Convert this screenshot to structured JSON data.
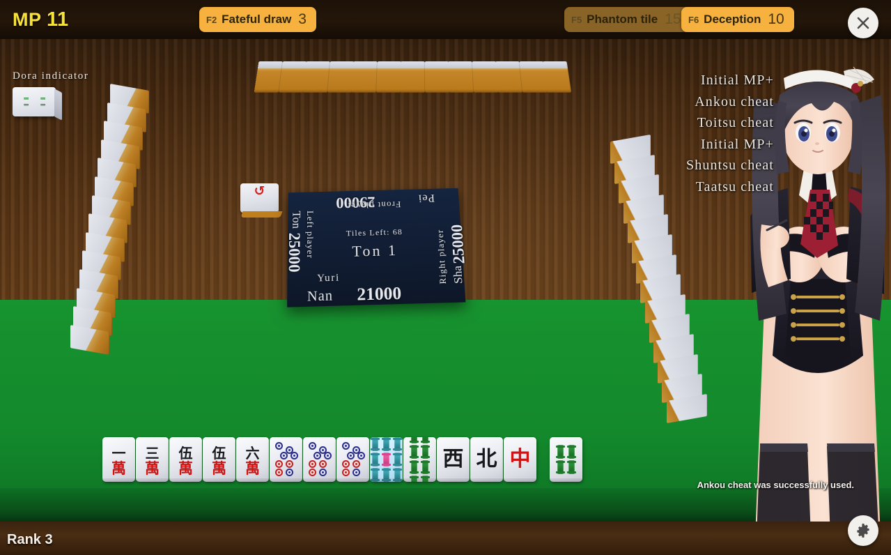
{
  "hud": {
    "mp_label": "MP",
    "mp_value": "11",
    "rank_label": "Rank 3",
    "status_message": "Ankou cheat was successfully used.",
    "close_icon": "close-icon",
    "settings_icon": "gear-icon"
  },
  "skills": [
    {
      "key": "F2",
      "name": "Fateful draw",
      "count": "3",
      "enabled": true
    },
    {
      "key": "F5",
      "name": "Phantom tile",
      "count": "15",
      "enabled": false
    },
    {
      "key": "F6",
      "name": "Deception",
      "count": "10",
      "enabled": true
    }
  ],
  "cheat_menu": {
    "items": [
      {
        "label": "Initial MP+"
      },
      {
        "label": "Ankou cheat"
      },
      {
        "label": "Toitsu cheat"
      },
      {
        "label": "Initial MP+"
      },
      {
        "label": "Shuntsu cheat"
      },
      {
        "label": "Taatsu cheat"
      }
    ]
  },
  "dora": {
    "label": "Dora indicator",
    "tile": "4-sou"
  },
  "scoreboard": {
    "tiles_left_label": "Tiles Left: 68",
    "round": "Ton 1",
    "front_player": {
      "name": "Front player",
      "wind": "Pei",
      "score": "29000"
    },
    "left_player": {
      "name": "Left player",
      "wind": "Ton",
      "score": "25000"
    },
    "right_player": {
      "name": "Right player",
      "wind": "Sha",
      "score": "25000"
    },
    "self_player": {
      "name": "Yuri",
      "wind": "Nan",
      "score": "21000"
    }
  },
  "turn_marker": {
    "glyph": "↺",
    "name": "dealer-marker"
  },
  "hand": {
    "tiles": [
      {
        "kind": "man",
        "num": "一",
        "wan": "萬",
        "label": "1-man",
        "selected": false
      },
      {
        "kind": "man",
        "num": "三",
        "wan": "萬",
        "label": "3-man",
        "selected": false
      },
      {
        "kind": "man",
        "num": "伍",
        "wan": "萬",
        "label": "5-man",
        "selected": false
      },
      {
        "kind": "man",
        "num": "伍",
        "wan": "萬",
        "label": "5-man",
        "selected": false
      },
      {
        "kind": "man",
        "num": "六",
        "wan": "萬",
        "label": "6-man",
        "selected": false
      },
      {
        "kind": "pin6",
        "label": "6-pin",
        "selected": false
      },
      {
        "kind": "pin6",
        "label": "6-pin",
        "selected": false
      },
      {
        "kind": "pin6",
        "label": "6-pin",
        "selected": false
      },
      {
        "kind": "sou5r",
        "label": "5-sou-red",
        "selected": true
      },
      {
        "kind": "sou8",
        "label": "8-sou",
        "selected": false
      },
      {
        "kind": "honor",
        "glyph": "西",
        "red": false,
        "label": "west-wind",
        "selected": false
      },
      {
        "kind": "honor",
        "glyph": "北",
        "red": false,
        "label": "north-wind",
        "selected": false
      },
      {
        "kind": "honor",
        "glyph": "中",
        "red": true,
        "label": "red-dragon",
        "selected": false
      }
    ],
    "drawn_tile": {
      "kind": "sou4",
      "label": "4-sou"
    }
  },
  "walls": {
    "top_count": 13,
    "left_count": 14,
    "right_count": 14
  },
  "colors": {
    "accent_gold": "#f6b13f",
    "accent_gold_dim": "#8a6427",
    "felt_green": "#179430",
    "frame_wood": "#b9761f",
    "mp_yellow": "#f7e23c",
    "board_navy": "#111d33"
  }
}
